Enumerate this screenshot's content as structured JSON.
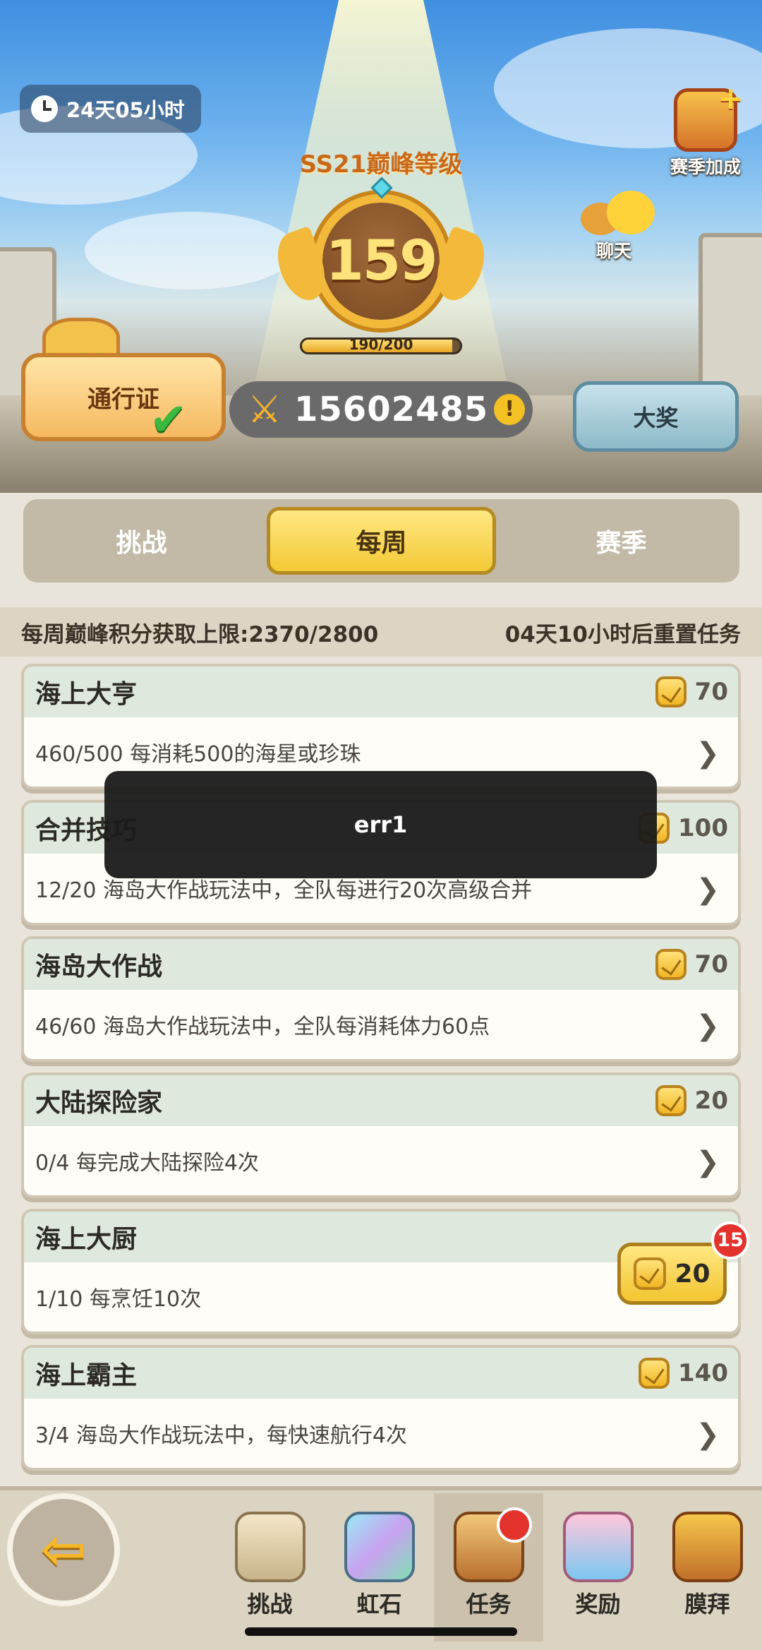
{
  "header": {
    "timer": "24天05小时",
    "season_title": "SS21巅峰等级",
    "level": "159",
    "xp_text": "190/200",
    "xp_fraction": 0.95,
    "pass_label": "通行证",
    "score": "15602485",
    "prize_label": "大奖",
    "bonus_label": "赛季加成",
    "chat_label": "聊天"
  },
  "tabs": [
    "挑战",
    "每周",
    "赛季"
  ],
  "info": {
    "limit_text": "每周巅峰积分获取上限:2370/2800",
    "reset_text": "04天10小时后重置任务"
  },
  "tasks": [
    {
      "title": "海上大亨",
      "reward": "70",
      "desc": "460/500 每消耗500的海星或珍珠"
    },
    {
      "title": "合并技巧",
      "reward": "100",
      "desc": "12/20 海岛大作战玩法中，全队每进行20次高级合并"
    },
    {
      "title": "海岛大作战",
      "reward": "70",
      "desc": "46/60 海岛大作战玩法中，全队每消耗体力60点"
    },
    {
      "title": "大陆探险家",
      "reward": "20",
      "desc": "0/4 每完成大陆探险4次"
    },
    {
      "title": "海上大厨",
      "reward": "",
      "desc": "1/10 每烹饪10次"
    },
    {
      "title": "海上霸主",
      "reward": "140",
      "desc": "3/4 海岛大作战玩法中，每快速航行4次"
    }
  ],
  "claim": {
    "reward": "20",
    "badge": "15"
  },
  "toast": "err1",
  "nav": [
    "挑战",
    "虹石",
    "任务",
    "奖励",
    "膜拜"
  ]
}
